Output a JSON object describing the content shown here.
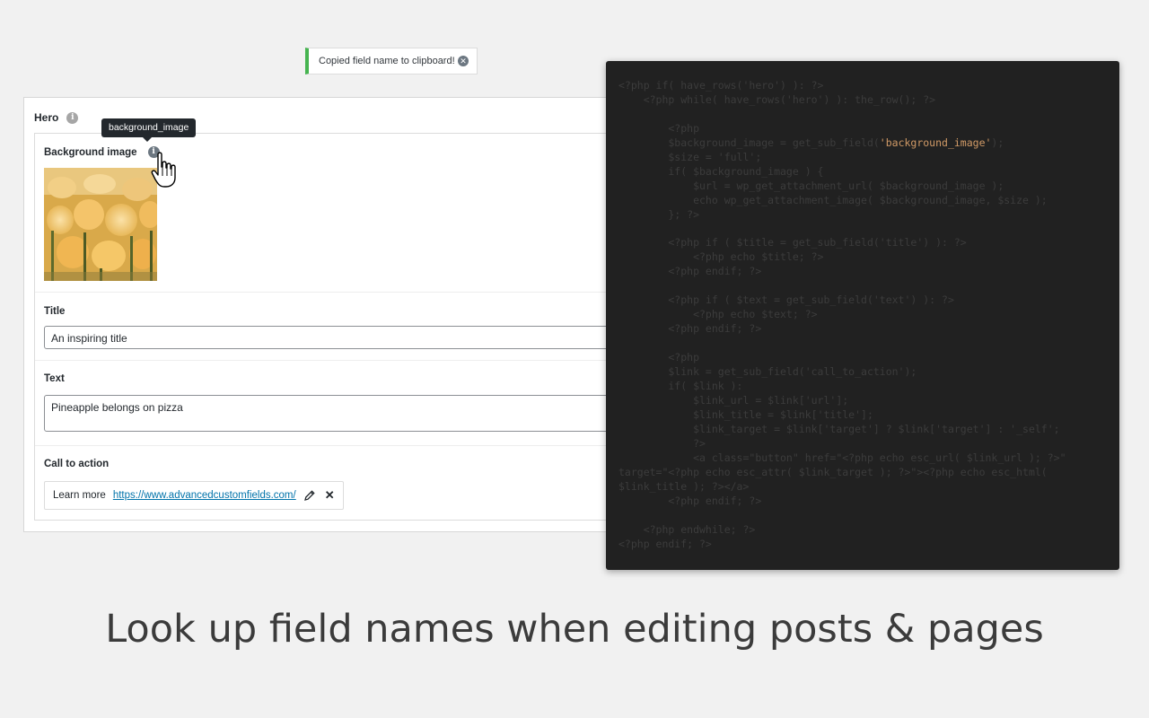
{
  "notice": {
    "text": "Copied field name to clipboard!",
    "dismiss_icon": "close-circle-icon"
  },
  "card": {
    "title": "Hero",
    "fields": {
      "background_image": {
        "label": "Background image",
        "tooltip": "background_image"
      },
      "title": {
        "label": "Title",
        "value": "An inspiring title"
      },
      "text": {
        "label": "Text",
        "value": "Pineapple belongs on pizza"
      },
      "cta": {
        "label": "Call to action",
        "link_title": "Learn more",
        "link_url": "https://www.advancedcustomfields.com/"
      }
    }
  },
  "code": {
    "lines_before": "<?php if( have_rows('hero') ): ?>\n    <?php while( have_rows('hero') ): the_row(); ?>\n\n        <?php\n        $background_image = get_sub_field(",
    "highlight": "'background_image'",
    "lines_after": ");\n        $size = 'full';\n        if( $background_image ) {\n            $url = wp_get_attachment_url( $background_image );\n            echo wp_get_attachment_image( $background_image, $size );\n        }; ?>\n\n        <?php if ( $title = get_sub_field('title') ): ?>\n            <?php echo $title; ?>\n        <?php endif; ?>\n\n        <?php if ( $text = get_sub_field('text') ): ?>\n            <?php echo $text; ?>\n        <?php endif; ?>\n\n        <?php\n        $link = get_sub_field('call_to_action');\n        if( $link ):\n            $link_url = $link['url'];\n            $link_title = $link['title'];\n            $link_target = $link['target'] ? $link['target'] : '_self';\n            ?>\n            <a class=\"button\" href=\"<?php echo esc_url( $link_url ); ?>\"\ntarget=\"<?php echo esc_attr( $link_target ); ?>\"><?php echo esc_html(\n$link_title ); ?></a>\n        <?php endif; ?>\n\n    <?php endwhile; ?>\n<?php endif; ?>"
  },
  "headline": "Look up field names when editing posts & pages",
  "colors": {
    "notice_accent": "#46b450",
    "link": "#0073aa",
    "code_bg": "#212121",
    "code_highlight": "#d19a66"
  }
}
